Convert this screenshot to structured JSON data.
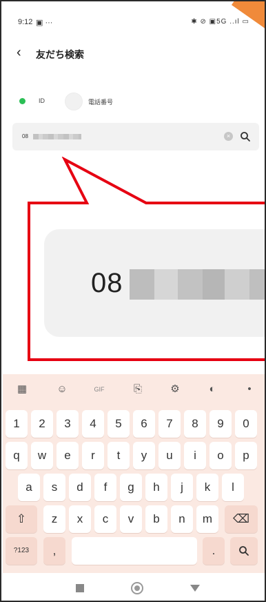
{
  "status_bar": {
    "time": "9:12",
    "left_icons": "▣ ···",
    "right_icons": "✱ ⊘ ▣5G ..ıl ▭"
  },
  "header": {
    "title": "友だち検索"
  },
  "search_type": {
    "options": [
      {
        "label": "ID",
        "selected": true
      },
      {
        "label": "電話番号",
        "selected": false
      }
    ]
  },
  "search": {
    "value": "08",
    "value_redacted": true,
    "clear_icon": "clear-icon",
    "search_icon": "search-icon"
  },
  "zoom_callout": {
    "value": "08",
    "value_redacted": true,
    "border_color": "#e60012"
  },
  "keyboard": {
    "toolbar": [
      "apps-icon",
      "sticker-icon",
      "GIF",
      "clipboard-icon",
      "settings-icon",
      "palette-icon",
      "mic-icon"
    ],
    "toolbar_gif_label": "GIF",
    "row_numbers": [
      "1",
      "2",
      "3",
      "4",
      "5",
      "6",
      "7",
      "8",
      "9",
      "0"
    ],
    "row_1": [
      "q",
      "w",
      "e",
      "r",
      "t",
      "y",
      "u",
      "i",
      "o",
      "p"
    ],
    "row_2": [
      "a",
      "s",
      "d",
      "f",
      "g",
      "h",
      "j",
      "k",
      "l"
    ],
    "row_3": [
      "z",
      "x",
      "c",
      "v",
      "b",
      "n",
      "m"
    ],
    "shift_label": "⇧",
    "delete_label": "⌫",
    "symbols_label": "?123",
    "comma_label": ",",
    "period_label": ".",
    "search_key_label": "🔍",
    "background": "#fbe9e2"
  },
  "colors": {
    "accent_green": "#2bbf55",
    "callout_red": "#e60012"
  }
}
